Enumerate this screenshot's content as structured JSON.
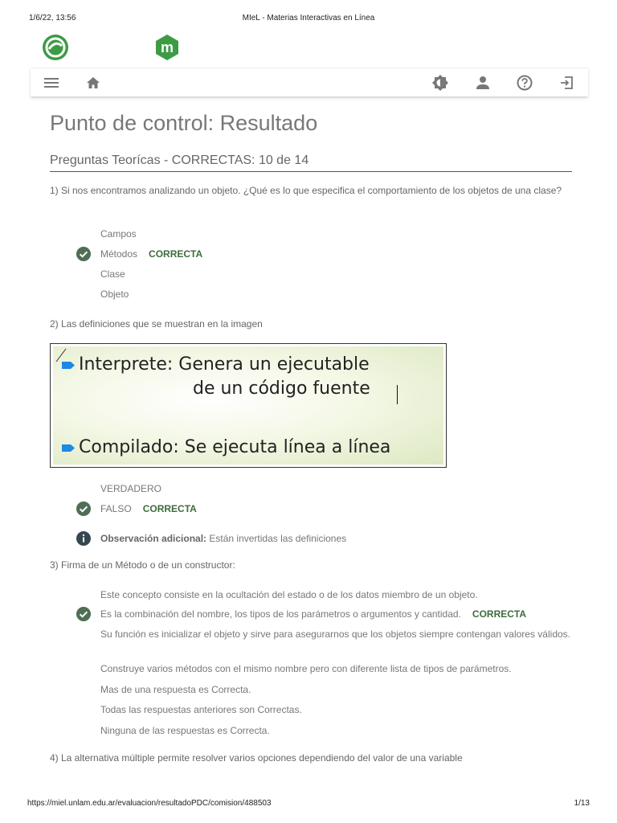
{
  "print_header": {
    "date": "1/6/22, 13:56",
    "title": "MIeL - Materias Interactivas en Línea"
  },
  "icons": {
    "logo_left": "unlam-logo-icon",
    "logo_right": "miel-logo-icon",
    "menu": "menu-icon",
    "home": "home-icon",
    "brightness": "brightness-icon",
    "user": "user-icon",
    "help": "help-icon",
    "logout": "logout-icon"
  },
  "logo_right_letter": "m",
  "colors": {
    "logo_green": "#3d9b45",
    "logo_green_dark": "#2e7d32",
    "check": "#4f6e55",
    "correct": "#3d6b3d",
    "info": "#37474f",
    "bullet": "#1e88e5"
  },
  "page_title": "Punto de control: Resultado",
  "section_title": "Preguntas Teorícas - CORRECTAS: 10 de 14",
  "correct_label": "CORRECTA",
  "questions": [
    {
      "text": "1) Si nos encontramos analizando un objeto. ¿Qué es lo que especifica el comportamiento de los objetos de una clase?",
      "options": [
        "Campos",
        "Métodos",
        "Clase",
        "Objeto"
      ]
    },
    {
      "text": "2) Las definiciones que se muestran en la imagen",
      "image_lines": [
        "Interprete: Genera un ejecutable",
        "de un código fuente",
        "Compilado: Se ejecuta línea a línea"
      ],
      "options": [
        "VERDADERO",
        "FALSO"
      ],
      "observation_label": "Observación adicional:",
      "observation_text": "Están invertidas las definiciones"
    },
    {
      "text": "3) Firma de un Método o de un constructor:",
      "options": [
        "Este concepto consiste en la ocultación del estado o de los datos miembro de un objeto.",
        "Es la combinación del nombre, los tipos de los parámetros o argumentos y cantidad.",
        "Su función es inicializar el objeto y sirve para asegurarnos que los objetos siempre contengan valores válidos.",
        "Construye varios métodos con el mismo nombre pero con diferente lista de tipos de parámetros.",
        "Mas de una respuesta es Correcta.",
        "Todas las respuestas anteriores son Correctas.",
        "Ninguna de las respuestas es Correcta."
      ]
    },
    {
      "text": "4) La alternativa múltiple permite resolver varios opciones dependiendo del valor de una variable"
    }
  ],
  "print_footer": {
    "url": "https://miel.unlam.edu.ar/evaluacion/resultadoPDC/comision/488503",
    "page": "1/13"
  }
}
